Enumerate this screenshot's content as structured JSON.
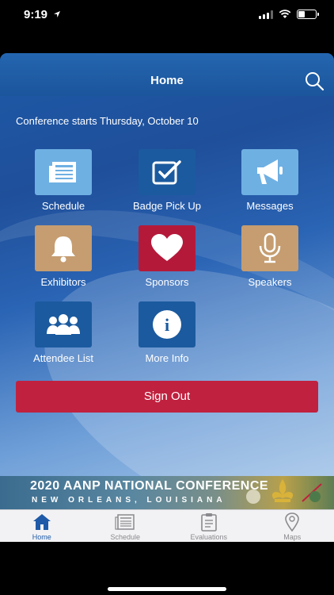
{
  "status": {
    "time": "9:19"
  },
  "header": {
    "title": "Home"
  },
  "notice": "Conference starts Thursday, October 10",
  "colors": {
    "light_blue_tile": "#6fb0e3",
    "dark_blue_tile": "#1b5a9e",
    "red_tile": "#b5193a",
    "tan_tile": "#c59d70",
    "sign_out": "#c0213f",
    "tab_active": "#1e5aa8"
  },
  "tiles": [
    {
      "label": "Schedule",
      "icon": "newspaper-icon"
    },
    {
      "label": "Badge Pick Up",
      "icon": "checkbox-icon"
    },
    {
      "label": "Messages",
      "icon": "megaphone-icon"
    },
    {
      "label": "Exhibitors",
      "icon": "bell-icon"
    },
    {
      "label": "Sponsors",
      "icon": "heart-icon"
    },
    {
      "label": "Speakers",
      "icon": "microphone-icon"
    },
    {
      "label": "Attendee List",
      "icon": "people-icon"
    },
    {
      "label": "More Info",
      "icon": "info-icon"
    }
  ],
  "sign_out_label": "Sign Out",
  "banner": {
    "line1": "2020 AANP NATIONAL CONFERENCE",
    "line2": "NEW ORLEANS, LOUISIANA"
  },
  "tabs": [
    {
      "label": "Home",
      "icon": "home-icon",
      "active": true
    },
    {
      "label": "Schedule",
      "icon": "schedule-icon",
      "active": false
    },
    {
      "label": "Evaluations",
      "icon": "clipboard-icon",
      "active": false
    },
    {
      "label": "Maps",
      "icon": "map-pin-icon",
      "active": false
    }
  ]
}
